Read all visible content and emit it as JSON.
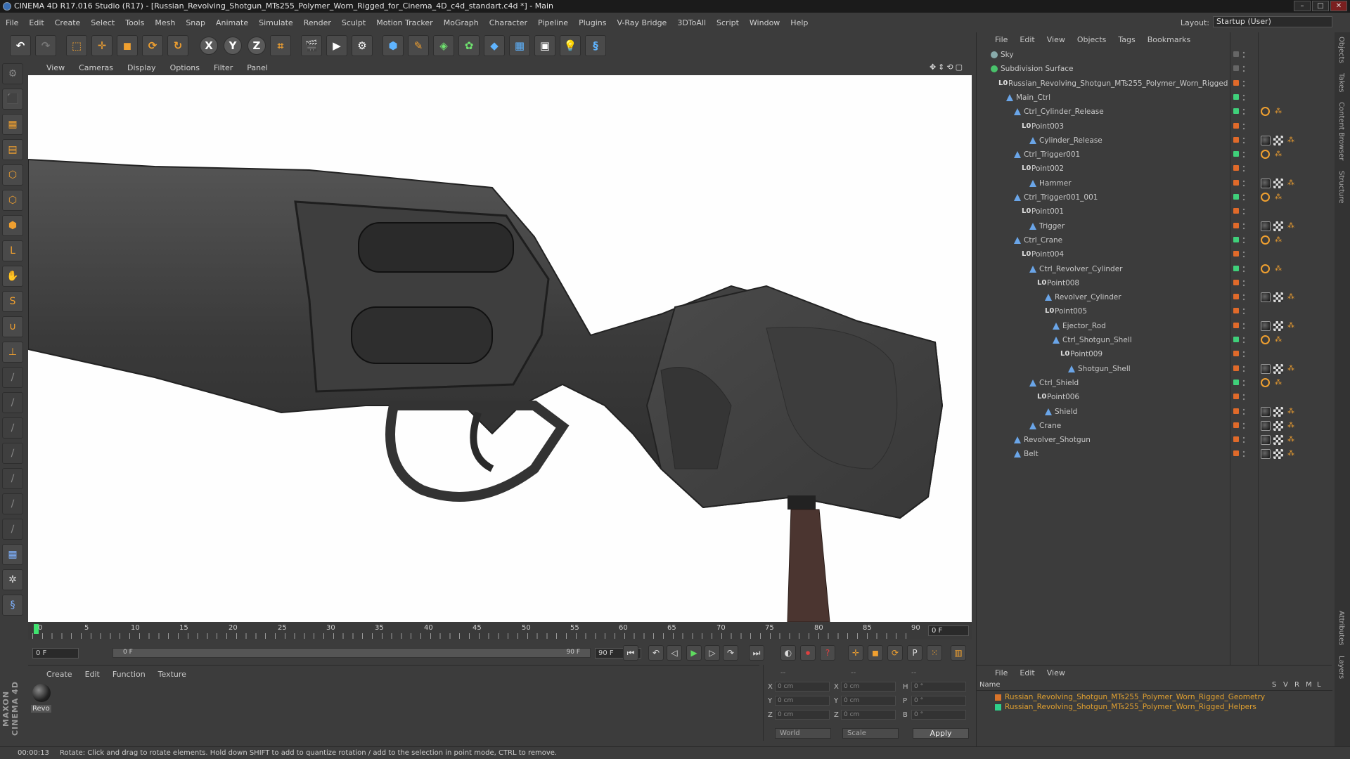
{
  "window": {
    "title": "CINEMA 4D R17.016 Studio (R17) - [Russian_Revolving_Shotgun_MTs255_Polymer_Worn_Rigged_for_Cinema_4D_c4d_standart.c4d *] - Main"
  },
  "menu": [
    "File",
    "Edit",
    "Create",
    "Select",
    "Tools",
    "Mesh",
    "Snap",
    "Animate",
    "Simulate",
    "Render",
    "Sculpt",
    "Motion Tracker",
    "MoGraph",
    "Character",
    "Pipeline",
    "Plugins",
    "V-Ray Bridge",
    "3DToAll",
    "Script",
    "Window",
    "Help"
  ],
  "layout": {
    "label": "Layout:",
    "value": "Startup (User)"
  },
  "viewport_menu": [
    "View",
    "Cameras",
    "Display",
    "Options",
    "Filter",
    "Panel"
  ],
  "timeline": {
    "ticks": [
      "0",
      "5",
      "10",
      "15",
      "20",
      "25",
      "30",
      "35",
      "40",
      "45",
      "50",
      "55",
      "60",
      "65",
      "70",
      "75",
      "80",
      "85",
      "90"
    ],
    "current_frame": "0 F"
  },
  "transport": {
    "start": "0 F",
    "range_start": "0 F",
    "range_end": "90 F",
    "end": "90 F"
  },
  "material_menu": [
    "Create",
    "Edit",
    "Function",
    "Texture"
  ],
  "material": {
    "label": "Revo"
  },
  "coords": {
    "x": "0 cm",
    "y": "0 cm",
    "z": "0 cm",
    "x2": "0 cm",
    "y2": "0 cm",
    "z2": "0 cm",
    "h": "0 °",
    "p": "0 °",
    "b": "0 °",
    "mode": "World",
    "scale": "Scale",
    "apply": "Apply",
    "top_left": "--",
    "top_mid": "--",
    "top_right": "--"
  },
  "object_menu": [
    "File",
    "Edit",
    "View",
    "Objects",
    "Tags",
    "Bookmarks"
  ],
  "objects": [
    {
      "name": "Sky",
      "indent": 0,
      "icon": "sky"
    },
    {
      "name": "Subdivision Surface",
      "indent": 0,
      "icon": "sub"
    },
    {
      "name": "Russian_Revolving_Shotgun_MTs255_Polymer_Worn_Rigged",
      "indent": 1,
      "icon": "lo"
    },
    {
      "name": "Main_Ctrl",
      "indent": 2,
      "icon": "null"
    },
    {
      "name": "Ctrl_Cylinder_Release",
      "indent": 3,
      "icon": "null"
    },
    {
      "name": "Point003",
      "indent": 4,
      "icon": "lo"
    },
    {
      "name": "Cylinder_Release",
      "indent": 5,
      "icon": "null"
    },
    {
      "name": "Ctrl_Trigger001",
      "indent": 3,
      "icon": "null"
    },
    {
      "name": "Point002",
      "indent": 4,
      "icon": "lo"
    },
    {
      "name": "Hammer",
      "indent": 5,
      "icon": "null"
    },
    {
      "name": "Ctrl_Trigger001_001",
      "indent": 3,
      "icon": "null"
    },
    {
      "name": "Point001",
      "indent": 4,
      "icon": "lo"
    },
    {
      "name": "Trigger",
      "indent": 5,
      "icon": "null"
    },
    {
      "name": "Ctrl_Crane",
      "indent": 3,
      "icon": "null"
    },
    {
      "name": "Point004",
      "indent": 4,
      "icon": "lo"
    },
    {
      "name": "Ctrl_Revolver_Cylinder",
      "indent": 5,
      "icon": "null"
    },
    {
      "name": "Point008",
      "indent": 6,
      "icon": "lo"
    },
    {
      "name": "Revolver_Cylinder",
      "indent": 7,
      "icon": "null"
    },
    {
      "name": "Point005",
      "indent": 7,
      "icon": "lo"
    },
    {
      "name": "Ejector_Rod",
      "indent": 8,
      "icon": "null"
    },
    {
      "name": "Ctrl_Shotgun_Shell",
      "indent": 8,
      "icon": "null"
    },
    {
      "name": "Point009",
      "indent": 9,
      "icon": "lo"
    },
    {
      "name": "Shotgun_Shell",
      "indent": 10,
      "icon": "null"
    },
    {
      "name": "Ctrl_Shield",
      "indent": 5,
      "icon": "null"
    },
    {
      "name": "Point006",
      "indent": 6,
      "icon": "lo"
    },
    {
      "name": "Shield",
      "indent": 7,
      "icon": "null"
    },
    {
      "name": "Crane",
      "indent": 5,
      "icon": "null"
    },
    {
      "name": "Revolver_Shotgun",
      "indent": 3,
      "icon": "null"
    },
    {
      "name": "Belt",
      "indent": 3,
      "icon": "null"
    }
  ],
  "layers_menu": [
    "File",
    "Edit",
    "View"
  ],
  "layers_header": {
    "name": "Name",
    "cols": [
      "S",
      "V",
      "R",
      "M",
      "L"
    ]
  },
  "layers": [
    {
      "name": "Russian_Revolving_Shotgun_MTs255_Polymer_Worn_Rigged_Geometry",
      "color": "#d8742a"
    },
    {
      "name": "Russian_Revolving_Shotgun_MTs255_Polymer_Worn_Rigged_Helpers",
      "color": "#2fd08a"
    }
  ],
  "side_tabs": [
    "Objects",
    "Takes",
    "Content Browser",
    "Structure"
  ],
  "side_tabs_bottom": [
    "Attributes",
    "Layers"
  ],
  "status": {
    "time": "00:00:13",
    "message": "Rotate: Click and drag to rotate elements. Hold down SHIFT to add to quantize rotation / add to the selection in point mode, CTRL to remove."
  },
  "maxon_logo": "MAXON CINEMA 4D",
  "colors": {
    "accent": "#f0a030",
    "bg": "#3c3c3c",
    "viewport": "#ffffff"
  }
}
